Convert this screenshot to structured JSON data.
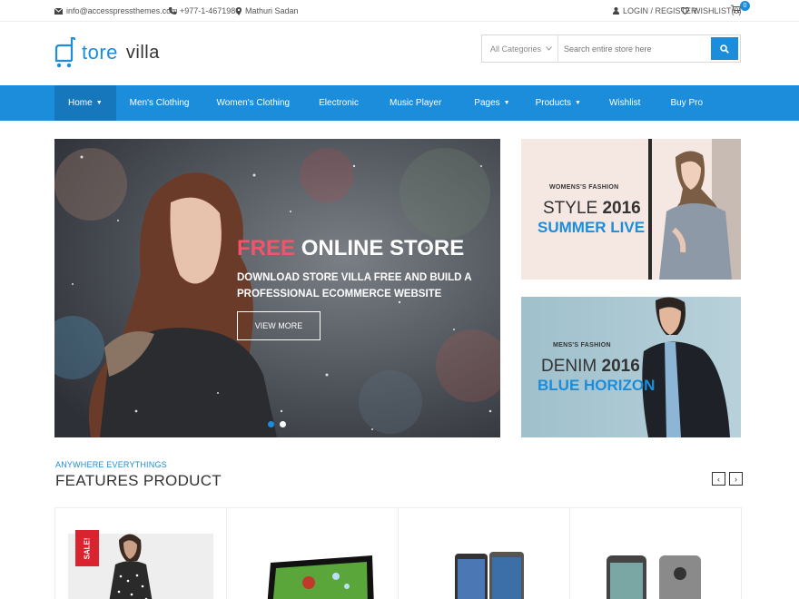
{
  "topbar": {
    "email": "info@accesspressthemes.com",
    "phone": "+977-1-4671980",
    "location": "Mathuri Sadan",
    "login": "LOGIN / REGISTER",
    "wishlist": "WISHLIST(0)",
    "cart_count": "0"
  },
  "logo": {
    "store": "tore",
    "villa": "villa"
  },
  "search": {
    "category": "All Categories",
    "placeholder": "Search entire store here"
  },
  "nav": {
    "items": [
      {
        "label": "Home"
      },
      {
        "label": "Men's Clothing"
      },
      {
        "label": "Women's Clothing"
      },
      {
        "label": "Electronic"
      },
      {
        "label": "Music Player"
      },
      {
        "label": "Pages"
      },
      {
        "label": "Products"
      },
      {
        "label": "Wishlist"
      },
      {
        "label": "Buy Pro"
      }
    ]
  },
  "hero": {
    "title_highlight": "FREE",
    "title_rest": "ONLINE STORE",
    "subtitle": "DOWNLOAD STORE VILLA FREE AND BUILD A PROFESSIONAL ECOMMERCE WEBSITE",
    "button": "VIEW MORE",
    "slide_index": 1,
    "slide_count": 2
  },
  "promos": [
    {
      "tag": "WOMENS'S FASHION",
      "line1_a": "STYLE",
      "line1_b": "2016",
      "line2": "SUMMER LIVE"
    },
    {
      "tag": "MENS'S FASHION",
      "line1_a": "DENIM",
      "line1_b": "2016",
      "line2": "BLUE HORIZON"
    }
  ],
  "features": {
    "kicker": "ANYWHERE EVERYTHINGS",
    "title": "FEATURES PRODUCT",
    "prev": "‹",
    "next": "›"
  },
  "products": [
    {
      "badge": "SALE!",
      "icon": "dress-product-image"
    },
    {
      "icon": "monitor-product-image"
    },
    {
      "icon": "phones-product-image"
    },
    {
      "icon": "phone-product-image"
    }
  ],
  "colors": {
    "accent": "#1c8ddb",
    "nav_active": "#1677bd",
    "hero_highlight": "#f2556b",
    "sale": "#d9232e"
  }
}
